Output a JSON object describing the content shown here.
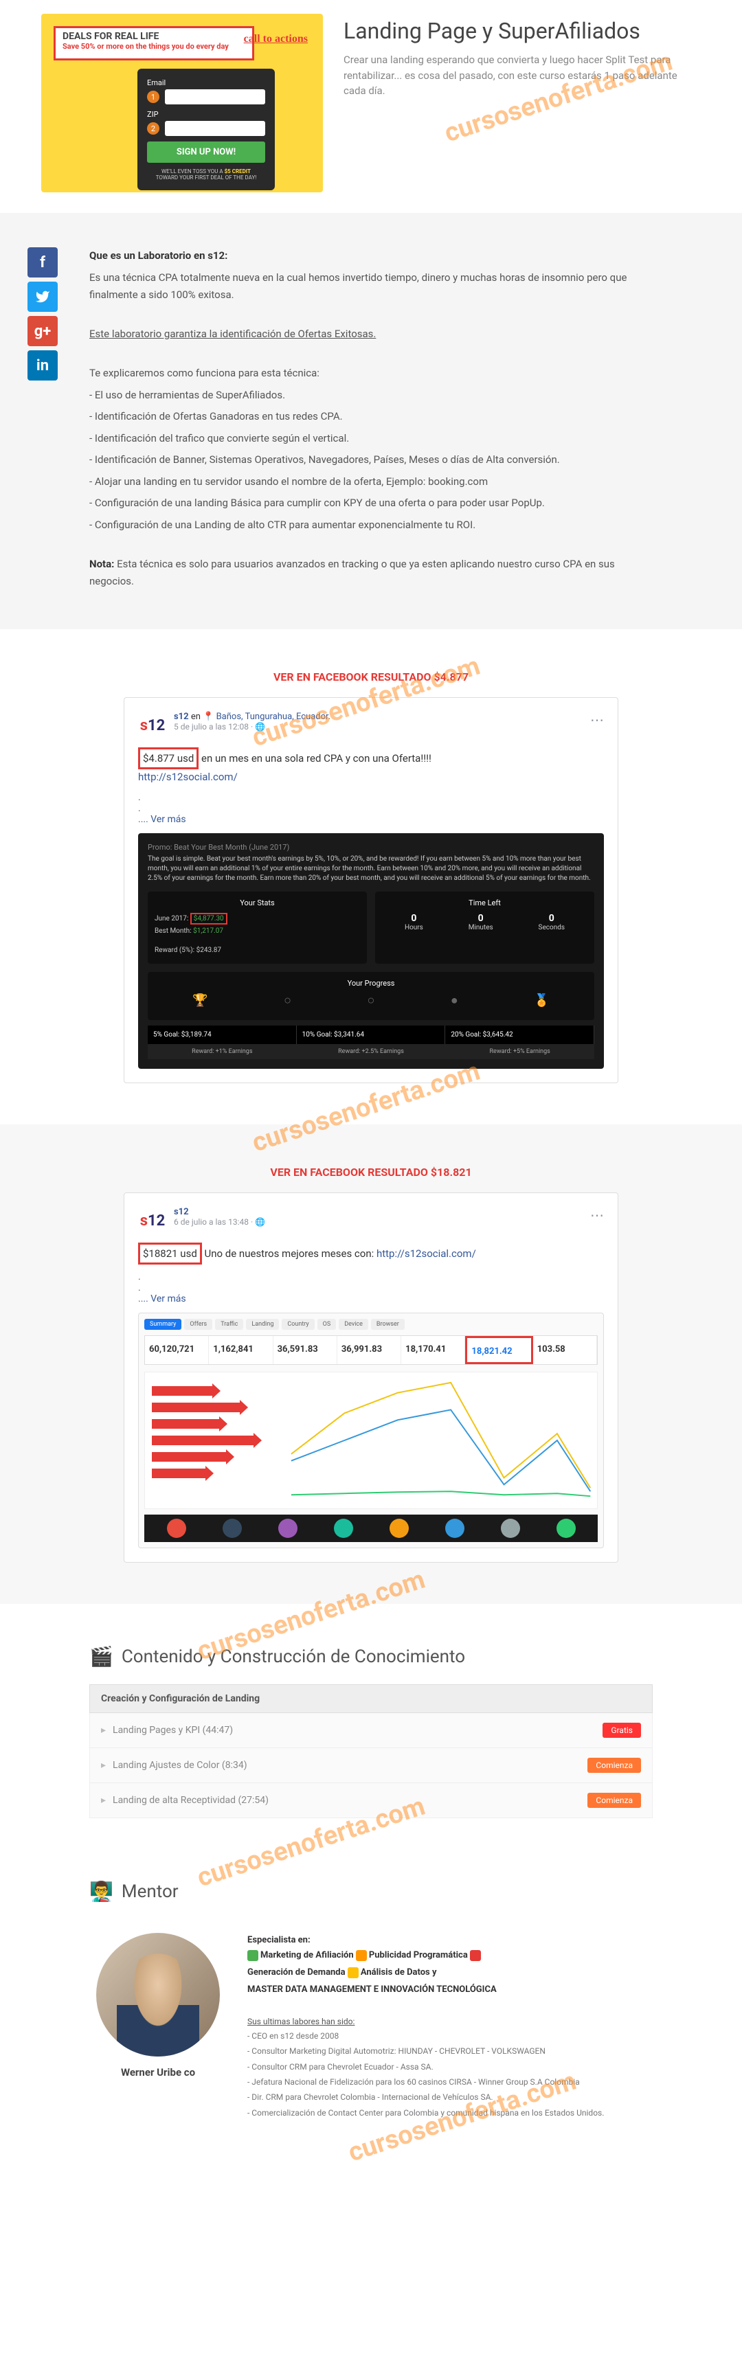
{
  "watermark": "cursosenoferta.com",
  "header": {
    "title": "Landing Page y SuperAfiliados",
    "subtitle": "Crear una landing esperando que convierta y luego hacer Split Test para rentabilizar... es cosa del pasado, con este curso estarás 1 paso adelante cada día.",
    "thumb": {
      "band_title": "DEALS FOR REAL LIFE",
      "band_sub": "Save 50% or more on the things you do every day",
      "cta": "call to actions",
      "email_label": "Email",
      "zip_label": "ZIP",
      "signup": "SIGN UP NOW!",
      "credit_pre": "WE'LL EVEN TOSS YOU A",
      "credit_amt": "$5 CREDIT",
      "credit_post": "TOWARD YOUR FIRST DEAL OF THE DAY!"
    }
  },
  "lab": {
    "title": "Que es un Laboratorio en s12:",
    "intro": "Es una técnica CPA totalmente nueva en la cual hemos invertido tiempo, dinero y muchas horas de insomnio pero que finalmente a sido 100% exitosa.",
    "guarantee": "Este laboratorio garantiza la identificación de Ofertas Exitosas.",
    "explain": "Te explicaremos como funciona para esta técnica:",
    "bullets": [
      "- El uso de herramientas de SuperAfiliados.",
      "- Identificación de Ofertas Ganadoras en tus redes CPA.",
      "- Identificación del trafico que convierte según el vertical.",
      "- Identificación de Banner, Sistemas Operativos, Navegadores, Países, Meses o días de Alta conversión.",
      "- Alojar una landing en tu servidor usando el nombre de la oferta, Ejemplo: booking.com",
      "- Configuración de una landing Básica para cumplir con KPY de una oferta o para poder usar PopUp.",
      "- Configuración de una Landing de alto CTR para aumentar exponencialmente tu ROI."
    ],
    "note_label": "Nota:",
    "note": "Esta técnica es solo para usuarios avanzados en tracking o que ya esten aplicando nuestro curso CPA en sus negocios."
  },
  "result1": {
    "link": "VER EN FACEBOOK RESULTADO $4.877",
    "name": "s12",
    "loc_pre": "en",
    "loc": "Baños, Tungurahua, Ecuador.",
    "date": "5 de julio a las 12:08",
    "amount": "$4.877 usd",
    "body_rest": "en un mes en una sola red CPA y con una Oferta!!!!",
    "url": "http://s12social.com/",
    "more": ".... Ver más",
    "promo": "Promo: Beat Your Best Month (June 2017)",
    "desc": "The goal is simple. Beat your best month's earnings by 5%, 10%, or 20%, and be rewarded! If you earn between 5% and 10% more than your best month, you will earn an additional 1% of your entire earnings for the month. Earn between 10% and 20% more, and you will receive an additional 2.5% of your earnings for the month. Earn more than 20% of your best month, and you will receive an additional 5% of your earnings for the month.",
    "stats_title": "Your Stats",
    "stats_june_label": "June 2017:",
    "stats_june": "$4,877.30",
    "stats_best_label": "Best Month:",
    "stats_best": "$1,217.07",
    "reward_label": "Reward (5%):",
    "reward": "$243.87",
    "time_title": "Time Left",
    "time_h": "0",
    "time_h_l": "Hours",
    "time_m": "0",
    "time_m_l": "Minutes",
    "time_s": "0",
    "time_s_l": "Seconds",
    "progress_title": "Your Progress",
    "goal5": "5% Goal: $3,189.74",
    "goal10": "10% Goal: $3,341.64",
    "goal20": "20% Goal: $3,645.42",
    "rw1": "Reward: +1% Earnings",
    "rw2": "Reward: +2.5% Earnings",
    "rw3": "Reward: +5% Earnings"
  },
  "result2": {
    "link": "VER EN FACEBOOK RESULTADO $18.821",
    "name": "s12",
    "date": "6 de julio a las 13:48",
    "amount": "$18821 usd",
    "body_rest": "Uno de nuestros mejores meses con:",
    "url": "http://s12social.com/",
    "more": ".... Ver más",
    "metrics": [
      {
        "lbl": "",
        "val": "60,120,721"
      },
      {
        "lbl": "",
        "val": "1,162,841"
      },
      {
        "lbl": "",
        "val": "36,591.83"
      },
      {
        "lbl": "",
        "val": "36,991.83"
      },
      {
        "lbl": "",
        "val": "18,170.41"
      },
      {
        "lbl": "",
        "val": "18,821.42"
      },
      {
        "lbl": "",
        "val": "103.58"
      }
    ]
  },
  "content": {
    "title": "Contenido y Construcción de Conocimiento",
    "accordion": "Creación y Configuración de Landing",
    "lessons": [
      {
        "title": "Landing Pages y KPI (44:47)",
        "badge": "Gratis",
        "cls": "badge-gratis"
      },
      {
        "title": "Landing Ajustes de Color (8:34)",
        "badge": "Comienza",
        "cls": "badge-comienza"
      },
      {
        "title": "Landing de alta Receptividad (27:54)",
        "badge": "Comienza",
        "cls": "badge-comienza"
      }
    ]
  },
  "mentor": {
    "title": "Mentor",
    "name": "Werner Uribe co",
    "spec_title": "Especialista en:",
    "spec1": "Marketing de Afiliación",
    "spec2": "Publicidad Programática",
    "spec3": "Generación de Demanda",
    "spec4": "Análisis de Datos y",
    "spec5": "MASTER DATA MANAGEMENT E INNOVACIÓN TECNOLÓGICA",
    "labores": "Sus ultimas labores han sido:",
    "items": [
      "- CEO en s12 desde 2008",
      "- Consultor Marketing Digital Automotriz: HIUNDAY - CHEVROLET - VOLKSWAGEN",
      "- Consultor CRM para Chevrolet Ecuador - Assa SA.",
      "- Jefatura Nacional de Fidelización para los 60 casinos CIRSA - Winner Group S.A Colombia",
      "- Dir. CRM para Chevrolet Colombia - Internacional de Vehículos SA.",
      "- Comercialización de Contact Center para Colombia y comunidad hispana en los Estados Unidos."
    ]
  }
}
